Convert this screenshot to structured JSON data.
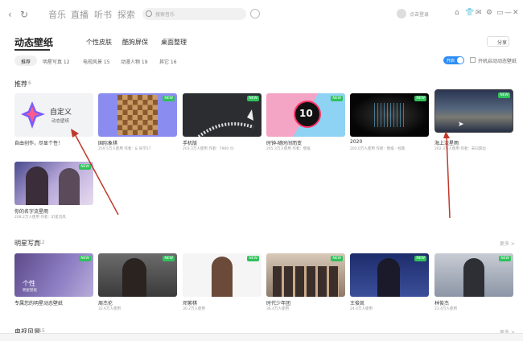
{
  "topbar": {
    "back": "‹",
    "refresh": "↻",
    "tabs": [
      "音乐",
      "直播",
      "听书",
      "探索"
    ],
    "search_placeholder": "搜索音乐",
    "login": "点击登录",
    "window_icons": [
      "⌂",
      "👕",
      "✉",
      "⚙",
      "▭",
      "—",
      "▢",
      "✕"
    ]
  },
  "header": {
    "tabs": [
      "动态壁纸",
      "个性皮肤",
      "酷狗屏保",
      "桌面整理"
    ],
    "share": "分享"
  },
  "filters": {
    "items": [
      "推荐",
      "明星写真 12",
      "电视风景 15",
      "动漫人物 19",
      "其它 16"
    ],
    "toggle": "开启",
    "checkbox_label": "开机启动动态壁纸"
  },
  "sections": {
    "recommend": {
      "title": "推荐",
      "count": "6"
    },
    "stars": {
      "title": "明星写真",
      "count": "12",
      "more": "更多 >"
    },
    "scenery": {
      "title": "电视风景",
      "count": "15",
      "more": "更多 >"
    }
  },
  "recommend_cards": [
    {
      "name": "自由创作，尽显个性！",
      "meta": "",
      "custom_title": "自定义",
      "custom_sub": "动态壁纸",
      "new": false
    },
    {
      "name": "国际象棋",
      "meta": "259.5万人使用   作者：& 同学27",
      "new": true
    },
    {
      "name": "手机版",
      "meta": "203.3万人使用   作者：7900 😊",
      "new": true
    },
    {
      "name": "时钟-随时间而变",
      "meta": "245.3万人使用   作者：壁纸",
      "big": "10",
      "new": true
    },
    {
      "name": "2020",
      "meta": "202.0万人使用   作者：壁纸 · 经典",
      "new": true
    },
    {
      "name": "海上流星雨",
      "meta": "202.3万人使用   作者：未归游边",
      "new": true
    },
    {
      "name": "你的名字流星雨",
      "meta": "208.2万人使用   作者：幻星流风",
      "new": true
    }
  ],
  "star_cards": [
    {
      "name": "专属您的明星动态壁纸",
      "meta": "",
      "overlay": "个性",
      "overlay_sub": "明星壁纸",
      "new": true
    },
    {
      "name": "周杰伦",
      "meta": "32.6万人使用",
      "new": true
    },
    {
      "name": "邓紫棋",
      "meta": "30.2万人使用",
      "new": true
    },
    {
      "name": "时代少年团",
      "meta": "36.4万人使用",
      "new": true
    },
    {
      "name": "王俊凯",
      "meta": "24.4万人使用",
      "new": true
    },
    {
      "name": "林俊杰",
      "meta": "23.4万人使用",
      "new": true
    }
  ],
  "badge_new": "NEW",
  "colors": {
    "accent": "#2f8ef4",
    "new_badge": "#2fc25b",
    "annotation": "#c0392b"
  }
}
